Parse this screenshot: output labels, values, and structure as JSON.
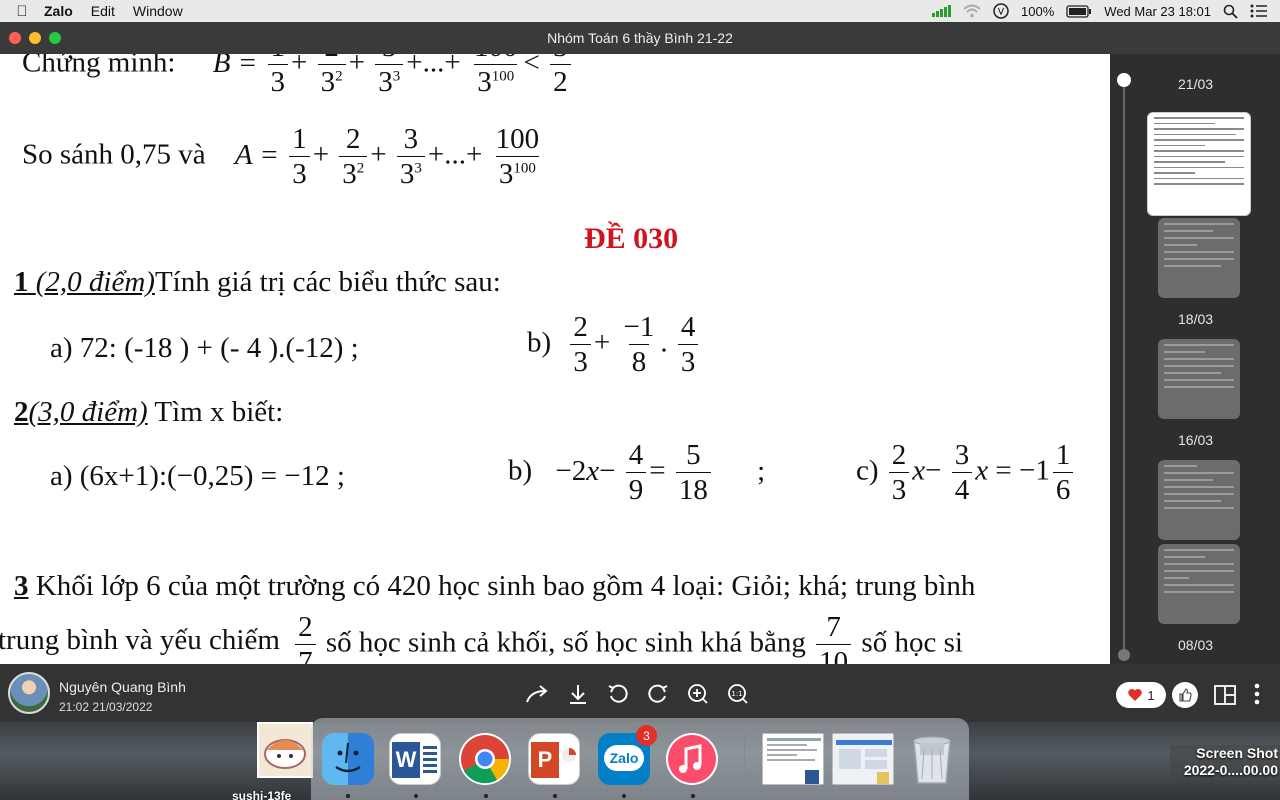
{
  "menubar": {
    "app": "Zalo",
    "items": [
      "Edit",
      "Window"
    ],
    "battery": "100%",
    "datetime": "Wed Mar 23  18:01"
  },
  "window": {
    "title": "Nhóm Toán 6 thầy Bình 21-22"
  },
  "document": {
    "top_cut": "Chứng minh:",
    "so_sanh": "So sánh 0,75 và",
    "de_title": "ĐỀ 030",
    "q1_num": "1",
    "q1_points": "(2,0 điểm)",
    "q1_text": "Tính giá trị các biểu thức sau:",
    "q1a": "a) 72: (-18 )  + (- 4 ).(-12)  ;",
    "q1b_label": "b)",
    "q2_num": "2",
    "q2_points": "(3,0 điểm)",
    "q2_text": " Tìm x biết:",
    "q2a": "a)  (6x+1):(−0,25) = −12  ;",
    "q2b_label": "b)",
    "q2c_label": "c)",
    "q3_num": "3",
    "q3_text": " Khối lớp 6 của một trường có 420 học sinh bao gồm 4 loại: Giỏi; khá; trung bình",
    "q3_line2a": "trung bình và yếu chiếm",
    "q3_line2b": "số học sinh cả khối, số học sinh khá bằng",
    "q3_line2c": "số học si"
  },
  "sidebar": {
    "dates": [
      "21/03",
      "18/03",
      "16/03",
      "08/03"
    ]
  },
  "infobar": {
    "sender": "Nguyên Quang Bình",
    "time": "21:02 21/03/2022",
    "reaction_count": "1",
    "tools": [
      "share-icon",
      "download-icon",
      "rotate-left-icon",
      "rotate-right-icon",
      "zoom-in-icon",
      "actual-size-icon"
    ]
  },
  "dock": {
    "zalo_label": "Zalo",
    "zalo_badge": "3",
    "word_label": "W",
    "ppt_label": "P"
  },
  "desktop": {
    "sushi_label": "sushi-13fe",
    "screenshot_line1": "Screen Shot",
    "screenshot_line2": "2022-0....00.00"
  }
}
